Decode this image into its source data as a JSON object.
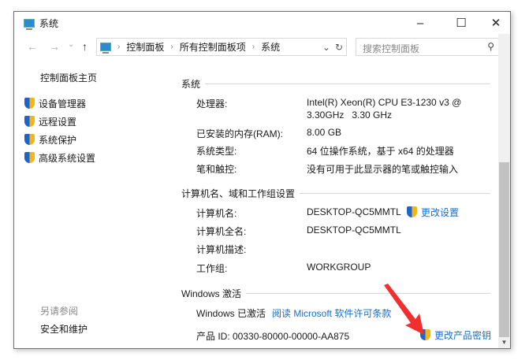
{
  "window": {
    "title": "系统",
    "minimize": "–",
    "maximize": "☐",
    "close": "✕"
  },
  "nav": {
    "back": "←",
    "forward": "→",
    "recent": "⌄",
    "up": "↑",
    "breadcrumb": [
      "控制面板",
      "所有控制面板项",
      "系统"
    ],
    "dropdown": "⌄",
    "refresh": "↻",
    "search_placeholder": "搜索控制面板",
    "search_icon": "⚲"
  },
  "sidebar": {
    "home": "控制面板主页",
    "items": [
      {
        "label": "设备管理器"
      },
      {
        "label": "远程设置"
      },
      {
        "label": "系统保护"
      },
      {
        "label": "高级系统设置"
      }
    ],
    "see_also": "另请参阅",
    "security": "安全和维护"
  },
  "system": {
    "heading": "系统",
    "rows": [
      {
        "label": "处理器:",
        "value": "Intel(R) Xeon(R) CPU E3-1230 v3 @",
        "value2": "3.30GHz   3.30 GHz"
      },
      {
        "label": "已安装的内存(RAM):",
        "value": "8.00 GB"
      },
      {
        "label": "系统类型:",
        "value": "64 位操作系统，基于 x64 的处理器"
      },
      {
        "label": "笔和触控:",
        "value": "没有可用于此显示器的笔或触控输入"
      }
    ]
  },
  "computer": {
    "heading": "计算机名、域和工作组设置",
    "change": "更改设置",
    "rows": [
      {
        "label": "计算机名:",
        "value": "DESKTOP-QC5MMTL"
      },
      {
        "label": "计算机全名:",
        "value": "DESKTOP-QC5MMTL"
      },
      {
        "label": "计算机描述:",
        "value": ""
      },
      {
        "label": "工作组:",
        "value": "WORKGROUP"
      }
    ]
  },
  "activation": {
    "heading": "Windows 激活",
    "status": "Windows 已激活",
    "license_link": "阅读 Microsoft 软件许可条款",
    "product_id": "产品 ID: 00330-80000-00000-AA875",
    "change_key": "更改产品密钥"
  },
  "colors": {
    "link": "#1a6fc4",
    "annotation_arrow": "#f03030"
  }
}
